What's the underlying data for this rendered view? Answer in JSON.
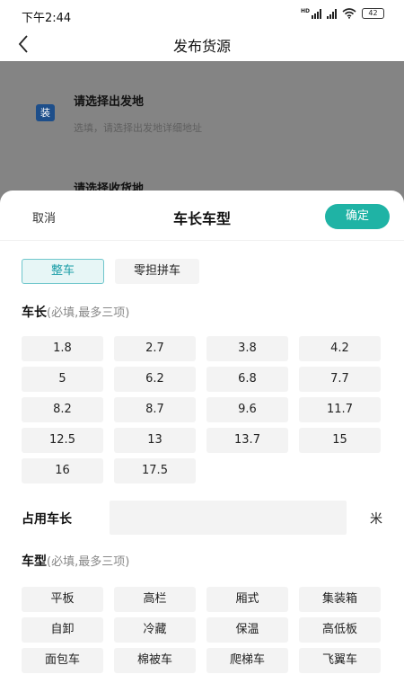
{
  "status_bar": {
    "time": "下午2:44",
    "network": "HD",
    "battery": "42"
  },
  "nav": {
    "title": "发布货源"
  },
  "background_page": {
    "load_badge": "装",
    "origin_title": "请选择出发地",
    "origin_subtitle": "选填，请选择出发地详细地址",
    "destination_title": "请选择收货地"
  },
  "sheet": {
    "cancel_label": "取消",
    "title": "车长车型",
    "confirm_label": "确定",
    "tabs": [
      {
        "label": "整车",
        "active": true
      },
      {
        "label": "零担拼车",
        "active": false
      }
    ],
    "length_section": {
      "label": "车长",
      "hint": "(必填,最多三项)"
    },
    "lengths": [
      "1.8",
      "2.7",
      "3.8",
      "4.2",
      "5",
      "6.2",
      "6.8",
      "7.7",
      "8.2",
      "8.7",
      "9.6",
      "11.7",
      "12.5",
      "13",
      "13.7",
      "15",
      "16",
      "17.5"
    ],
    "occupy": {
      "label": "占用车长",
      "value": "",
      "unit": "米"
    },
    "type_section": {
      "label": "车型",
      "hint": "(必填,最多三项)"
    },
    "types": [
      "平板",
      "高栏",
      "厢式",
      "集装箱",
      "自卸",
      "冷藏",
      "保温",
      "高低板",
      "面包车",
      "棉被车",
      "爬梯车",
      "飞翼车"
    ]
  },
  "colors": {
    "accent": "#1fb3a5",
    "badge": "#1d4e8a",
    "overlay": "#848484"
  }
}
